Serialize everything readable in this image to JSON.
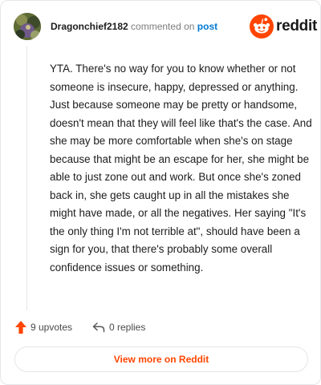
{
  "header": {
    "username": "Dragonchief2182",
    "verb": "commented on",
    "post_link": "post"
  },
  "brand": {
    "wordmark": "reddit",
    "icon": "reddit-logo-icon",
    "color": "#ff4500"
  },
  "comment": {
    "text": "YTA. There's no way for you to know whether or not someone is insecure, happy, depressed or anything. Just because someone may be pretty or handsome, doesn't mean that they will feel like that's the case. And she may be more comfortable when she's on stage because that might be an escape for her, she might be able to just zone out and work. But once she's zoned back in, she gets caught up in all the mistakes she might have made, or all the negatives. Her saying \"It's the only thing I'm not terrible at\", should have been a sign for you, that there's probably some overall confidence issues or something."
  },
  "actions": {
    "upvotes_label": "9 upvotes",
    "upvote_icon": "upvote-arrow-icon",
    "replies_label": "0 replies",
    "reply_icon": "reply-arrow-icon"
  },
  "footer": {
    "view_more_label": "View more on Reddit"
  },
  "colors": {
    "accent": "#ff4500",
    "link": "#0079d3",
    "border": "#e4e6e8"
  }
}
